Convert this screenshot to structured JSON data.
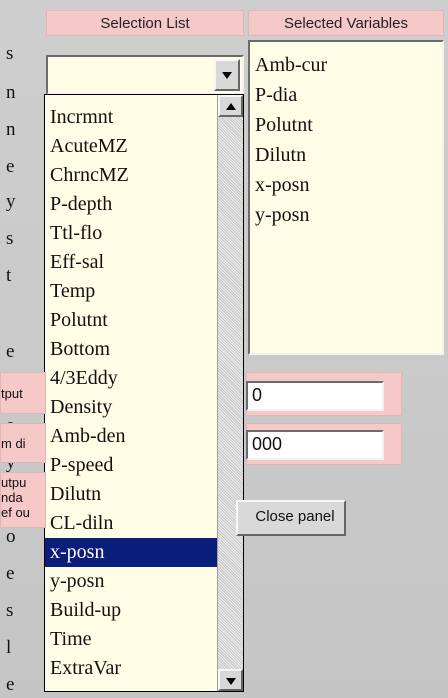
{
  "headers": {
    "selection_list": "Selection List",
    "selected_variables": "Selected Variables"
  },
  "left_fragments": [
    "s",
    "n",
    "n",
    "e",
    "y",
    "s",
    "t",
    "e",
    "o",
    "e",
    "y",
    "e",
    "o",
    "e",
    "s",
    "l",
    "e"
  ],
  "combo": {
    "value": ""
  },
  "selection_options": [
    "Incrmnt",
    "AcuteMZ",
    "ChrncMZ",
    "P-depth",
    "Ttl-flo",
    "Eff-sal",
    "Temp",
    "Polutnt",
    "Bottom",
    "4/3Eddy",
    "Density",
    "Amb-den",
    "P-speed",
    "Dilutn",
    "CL-diln",
    "x-posn",
    "y-posn",
    "Build-up",
    "Time",
    "ExtraVar"
  ],
  "selected_option_index": 15,
  "selected_variables": [
    "Amb-cur",
    "P-dia",
    "Polutnt",
    "Dilutn",
    "x-posn",
    "y-posn"
  ],
  "form_labels": [
    "tput",
    "m di",
    "utpu\nnda\nef ou"
  ],
  "form_values": [
    "0",
    "000"
  ],
  "buttons": {
    "close_panel": "Close panel"
  }
}
